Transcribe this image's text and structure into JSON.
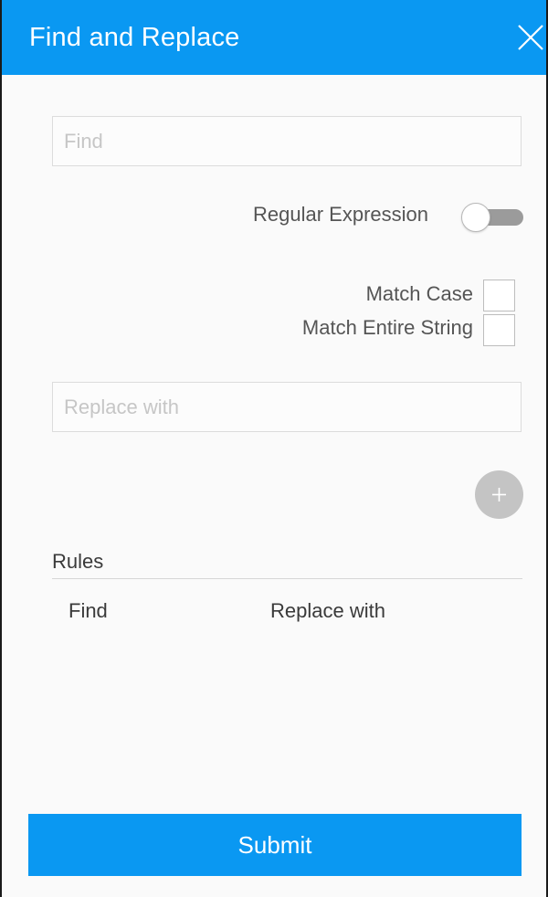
{
  "dialog": {
    "title": "Find and Replace",
    "close_icon": "close-icon"
  },
  "find": {
    "placeholder": "Find",
    "value": ""
  },
  "options": {
    "regex_label": "Regular Expression",
    "regex_enabled": false,
    "match_case_label": "Match Case",
    "match_case_checked": false,
    "match_entire_label": "Match Entire String",
    "match_entire_checked": false
  },
  "replace": {
    "placeholder": "Replace with",
    "value": ""
  },
  "add_button_icon": "plus-icon",
  "rules": {
    "heading": "Rules",
    "columns": [
      "Find",
      "Replace with"
    ],
    "rows": []
  },
  "submit_label": "Submit",
  "colors": {
    "accent": "#0a98f2",
    "add_button": "#c4c4c4",
    "toggle_track": "#9b9b9b"
  }
}
